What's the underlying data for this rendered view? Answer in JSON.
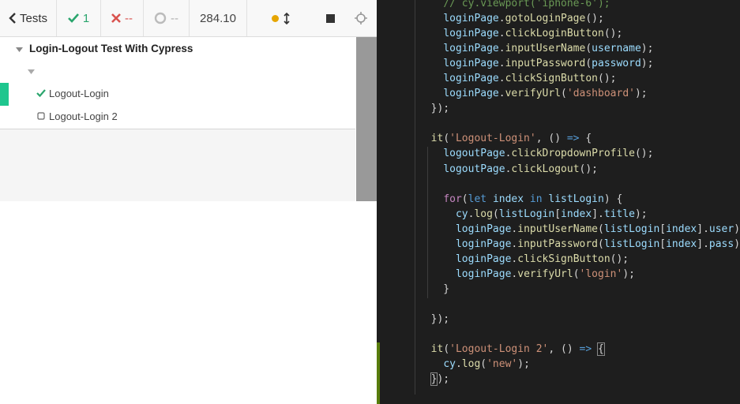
{
  "toolbar": {
    "tests_label": "Tests",
    "passed_count": "1",
    "failed_count": "--",
    "pending_count": "--",
    "duration": "284.10"
  },
  "reporter": {
    "suite_title": "Login-Logout Test With Cypress",
    "tests": [
      {
        "label": "Logout-Login",
        "state": "passed"
      },
      {
        "label": "Logout-Login 2",
        "state": "pending"
      }
    ]
  },
  "colors": {
    "pass": "#2aa56d",
    "fail": "#d9534f",
    "active_bar": "#1ec68e",
    "editor_bg": "#1e1e1e"
  },
  "editor": {
    "lines": [
      [
        [
          "",
          "    "
        ],
        [
          "cm",
          "// cy.viewport('iphone-6');"
        ]
      ],
      [
        [
          "",
          "    "
        ],
        [
          "vr",
          "loginPage"
        ],
        [
          "",
          "."
        ],
        [
          "fn",
          "gotoLoginPage"
        ],
        [
          "",
          "();"
        ]
      ],
      [
        [
          "",
          "    "
        ],
        [
          "vr",
          "loginPage"
        ],
        [
          "",
          "."
        ],
        [
          "fn",
          "clickLoginButton"
        ],
        [
          "",
          "();"
        ]
      ],
      [
        [
          "",
          "    "
        ],
        [
          "vr",
          "loginPage"
        ],
        [
          "",
          "."
        ],
        [
          "fn",
          "inputUserName"
        ],
        [
          "",
          "("
        ],
        [
          "vr",
          "username"
        ],
        [
          "",
          ");"
        ]
      ],
      [
        [
          "",
          "    "
        ],
        [
          "vr",
          "loginPage"
        ],
        [
          "",
          "."
        ],
        [
          "fn",
          "inputPassword"
        ],
        [
          "",
          "("
        ],
        [
          "vr",
          "password"
        ],
        [
          "",
          ");"
        ]
      ],
      [
        [
          "",
          "    "
        ],
        [
          "vr",
          "loginPage"
        ],
        [
          "",
          "."
        ],
        [
          "fn",
          "clickSignButton"
        ],
        [
          "",
          "();"
        ]
      ],
      [
        [
          "",
          "    "
        ],
        [
          "vr",
          "loginPage"
        ],
        [
          "",
          "."
        ],
        [
          "fn",
          "verifyUrl"
        ],
        [
          "",
          "("
        ],
        [
          "st",
          "'dashboard'"
        ],
        [
          "",
          ");"
        ]
      ],
      [
        [
          "",
          "  });"
        ]
      ],
      [
        [
          "",
          ""
        ]
      ],
      [
        [
          "",
          "  "
        ],
        [
          "fn",
          "it"
        ],
        [
          "",
          "("
        ],
        [
          "st",
          "'Logout-Login'"
        ],
        [
          "",
          ", () "
        ],
        [
          "kw",
          "=>"
        ],
        [
          "",
          " {"
        ]
      ],
      [
        [
          "",
          "    "
        ],
        [
          "vr",
          "logoutPage"
        ],
        [
          "",
          "."
        ],
        [
          "fn",
          "clickDropdownProfile"
        ],
        [
          "",
          "();"
        ]
      ],
      [
        [
          "",
          "    "
        ],
        [
          "vr",
          "logoutPage"
        ],
        [
          "",
          "."
        ],
        [
          "fn",
          "clickLogout"
        ],
        [
          "",
          "();"
        ]
      ],
      [
        [
          "",
          ""
        ]
      ],
      [
        [
          "",
          "    "
        ],
        [
          "cf",
          "for"
        ],
        [
          "",
          "("
        ],
        [
          "kw",
          "let"
        ],
        [
          "",
          " "
        ],
        [
          "vr",
          "index"
        ],
        [
          "",
          " "
        ],
        [
          "kw",
          "in"
        ],
        [
          "",
          " "
        ],
        [
          "vr",
          "listLogin"
        ],
        [
          "",
          ") {"
        ]
      ],
      [
        [
          "",
          "      "
        ],
        [
          "vr",
          "cy"
        ],
        [
          "",
          "."
        ],
        [
          "fn",
          "log"
        ],
        [
          "",
          "("
        ],
        [
          "vr",
          "listLogin"
        ],
        [
          "",
          "["
        ],
        [
          "vr",
          "index"
        ],
        [
          "",
          "]."
        ],
        [
          "vr",
          "title"
        ],
        [
          "",
          ");"
        ]
      ],
      [
        [
          "",
          "      "
        ],
        [
          "vr",
          "loginPage"
        ],
        [
          "",
          "."
        ],
        [
          "fn",
          "inputUserName"
        ],
        [
          "",
          "("
        ],
        [
          "vr",
          "listLogin"
        ],
        [
          "",
          "["
        ],
        [
          "vr",
          "index"
        ],
        [
          "",
          "]."
        ],
        [
          "vr",
          "user"
        ],
        [
          "",
          ");"
        ]
      ],
      [
        [
          "",
          "      "
        ],
        [
          "vr",
          "loginPage"
        ],
        [
          "",
          "."
        ],
        [
          "fn",
          "inputPassword"
        ],
        [
          "",
          "("
        ],
        [
          "vr",
          "listLogin"
        ],
        [
          "",
          "["
        ],
        [
          "vr",
          "index"
        ],
        [
          "",
          "]."
        ],
        [
          "vr",
          "pass"
        ],
        [
          "",
          ");"
        ]
      ],
      [
        [
          "",
          "      "
        ],
        [
          "vr",
          "loginPage"
        ],
        [
          "",
          "."
        ],
        [
          "fn",
          "clickSignButton"
        ],
        [
          "",
          "();"
        ]
      ],
      [
        [
          "",
          "      "
        ],
        [
          "vr",
          "loginPage"
        ],
        [
          "",
          "."
        ],
        [
          "fn",
          "verifyUrl"
        ],
        [
          "",
          "("
        ],
        [
          "st",
          "'login'"
        ],
        [
          "",
          ");"
        ]
      ],
      [
        [
          "",
          "    }"
        ]
      ],
      [
        [
          "",
          ""
        ]
      ],
      [
        [
          "",
          "  });"
        ]
      ],
      [
        [
          "",
          ""
        ]
      ],
      [
        [
          "",
          "  "
        ],
        [
          "fn",
          "it"
        ],
        [
          "",
          "("
        ],
        [
          "st",
          "'Logout-Login 2'"
        ],
        [
          "",
          ", () "
        ],
        [
          "kw",
          "=>"
        ],
        [
          "",
          " "
        ],
        [
          "brk",
          "{"
        ]
      ],
      [
        [
          "",
          "    "
        ],
        [
          "vr",
          "cy"
        ],
        [
          "",
          "."
        ],
        [
          "fn",
          "log"
        ],
        [
          "",
          "("
        ],
        [
          "st",
          "'new'"
        ],
        [
          "",
          ");"
        ]
      ],
      [
        [
          "",
          "  "
        ],
        [
          "brk",
          "}"
        ],
        [
          "",
          ");"
        ]
      ]
    ]
  }
}
